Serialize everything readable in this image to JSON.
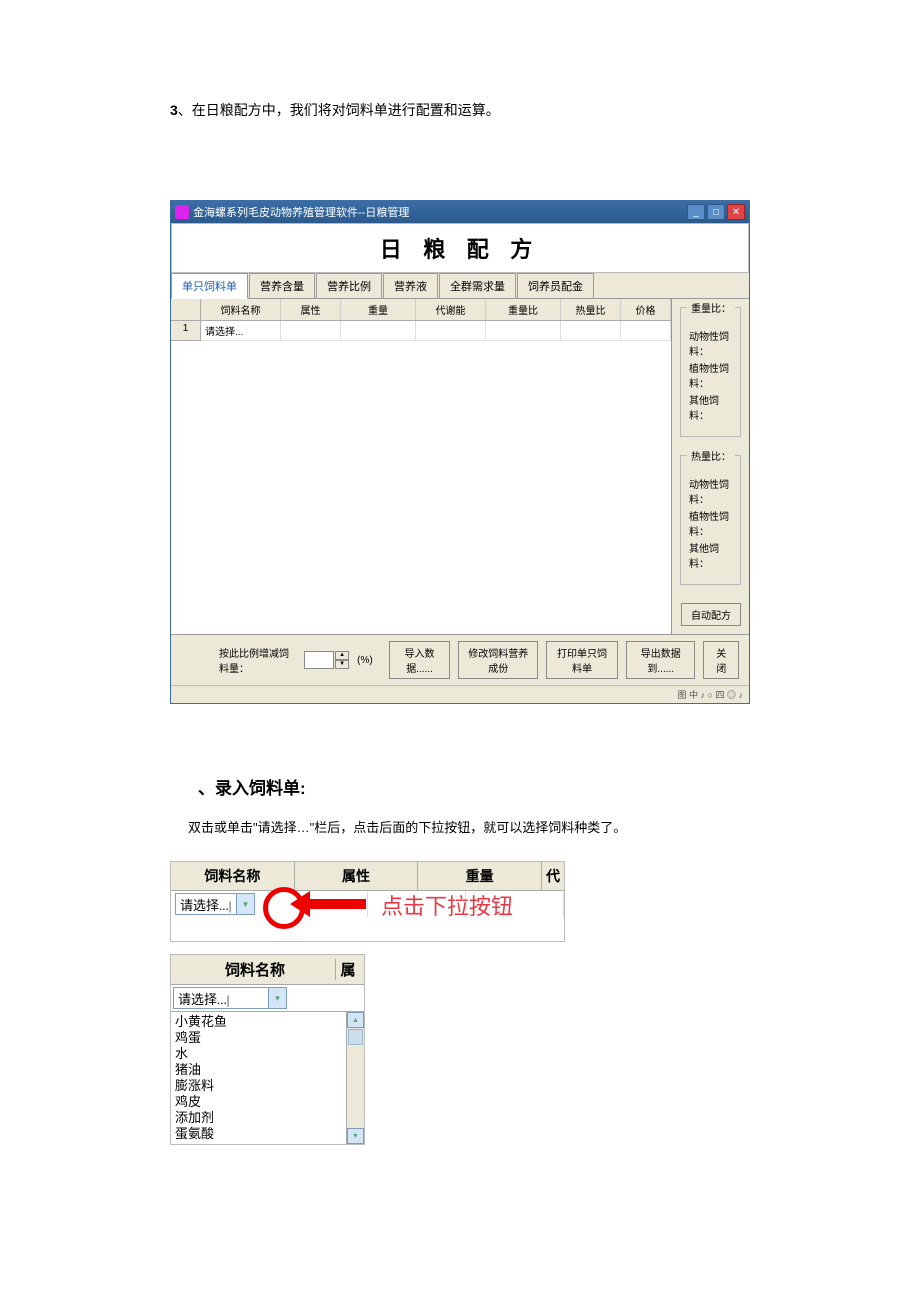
{
  "intro": {
    "num": "3",
    "text": "、在日粮配方中，我们将对饲料单进行配置和运算。"
  },
  "window": {
    "title": "金海螺系列毛皮动物养殖管理软件--日粮管理",
    "big_title": "日 粮 配 方",
    "tabs": [
      "单只饲料单",
      "营养含量",
      "营养比例",
      "营养液",
      "全群需求量",
      "饲养员配金"
    ],
    "columns": [
      "饲料名称",
      "属性",
      "重量",
      "代谢能",
      "重量比",
      "热量比",
      "价格"
    ],
    "first_row_num": "1",
    "first_cell": "请选择...",
    "group_weight": {
      "title": "重量比：",
      "items": [
        "动物性饲料：",
        "植物性饲料：",
        "其他饲料："
      ]
    },
    "group_energy": {
      "title": "热量比：",
      "items": [
        "动物性饲料：",
        "植物性饲料：",
        "其他饲料："
      ]
    },
    "auto_btn": "自动配方",
    "bottom": {
      "label": "按此比例增减饲料量：",
      "unit": "(%)",
      "btn_import": "导入数据......",
      "btn_modify": "修改饲料营养成份",
      "btn_print": "打印单只饲料单",
      "btn_export": "导出数据到......",
      "btn_close": "关 闭"
    }
  },
  "section": {
    "title": "、录入饲料单:",
    "desc": "双击或单击\"请选择…\"栏后，点击后面的下拉按钮，就可以选择饲料种类了。"
  },
  "combo1": {
    "col1": "饲料名称",
    "col2": "属性",
    "col3": "重量",
    "col4": "代",
    "select_val": "请选择...|",
    "annotation": "点击下拉按钮"
  },
  "combo2": {
    "col1": "饲料名称",
    "col2": "属",
    "select_val": "请选择...|",
    "options": [
      "小黄花鱼",
      "鸡蛋",
      "水",
      "猪油",
      "膨涨料",
      "鸡皮",
      "添加剂",
      "蛋氨酸"
    ]
  }
}
